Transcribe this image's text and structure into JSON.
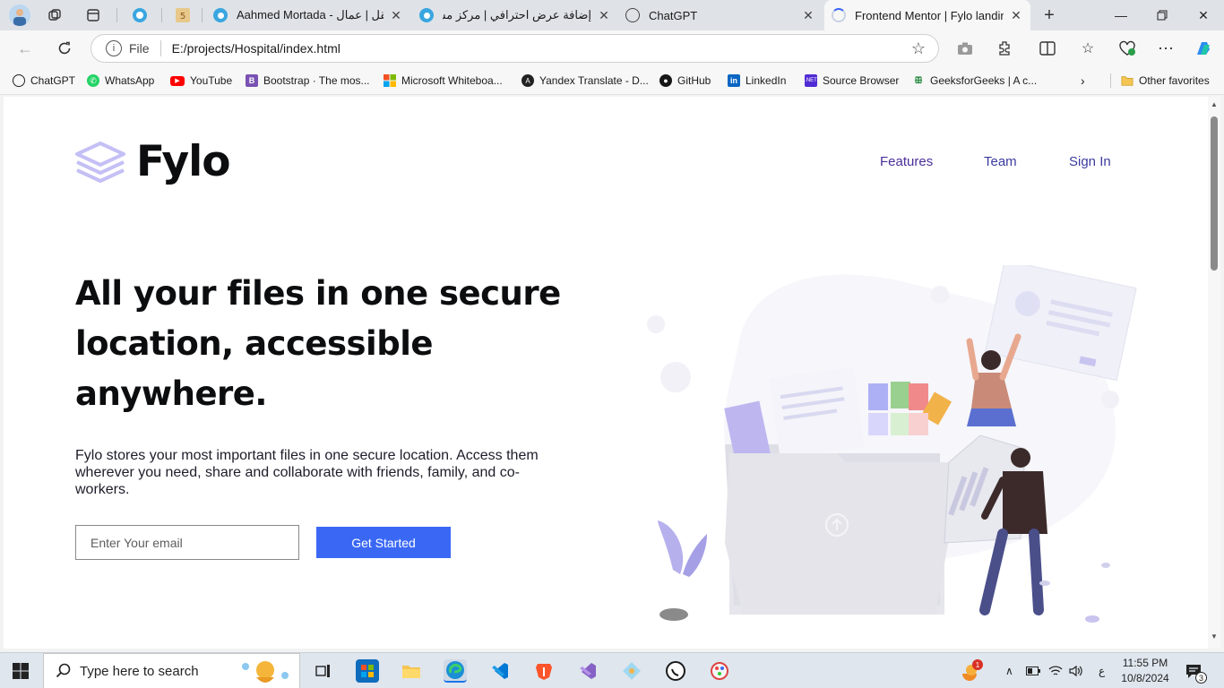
{
  "browser": {
    "tabs": [
      {
        "label": "Aahmed Mortada - مستقل | عمال",
        "icon": "globe-icon"
      },
      {
        "label": "إضافة عرض احترافي | مركز مساعد",
        "icon": "globe-icon"
      },
      {
        "label": "ChatGPT",
        "icon": "openai-icon"
      },
      {
        "label": "Frontend Mentor | Fylo landing",
        "icon": "loading-icon"
      }
    ],
    "address_scheme": "File",
    "address": "E:/projects/Hospital/index.html"
  },
  "favorites": [
    {
      "label": "ChatGPT",
      "icon": "openai-icon",
      "color": "#222222"
    },
    {
      "label": "WhatsApp",
      "icon": "whatsapp-icon",
      "color": "#25D366"
    },
    {
      "label": "YouTube",
      "icon": "youtube-icon",
      "color": "#FF0000"
    },
    {
      "label": "Bootstrap · The mos...",
      "icon": "bootstrap-icon",
      "color": "#7952B3"
    },
    {
      "label": "Microsoft Whiteboa...",
      "icon": "microsoft-icon",
      "color": "#F25022"
    },
    {
      "label": "Yandex Translate - D...",
      "icon": "yandex-icon",
      "color": "#E62E2E"
    },
    {
      "label": "GitHub",
      "icon": "github-icon",
      "color": "#181717"
    },
    {
      "label": "LinkedIn",
      "icon": "linkedin-icon",
      "color": "#0A66C2"
    },
    {
      "label": "Source Browser",
      "icon": "dotnet-icon",
      "color": "#512BD4"
    },
    {
      "label": "GeeksforGeeks | A c...",
      "icon": "gfg-icon",
      "color": "#2F8D46"
    }
  ],
  "other_favorites": "Other favorites",
  "page": {
    "logo_text": "Fylo",
    "nav": [
      "Features",
      "Team",
      "Sign In"
    ],
    "title": "All your files in one secure location, accessible anywhere.",
    "text": "Fylo stores your most important files in one secure location. Access them wherever you need, share and collaborate with friends, family, and co-workers.",
    "email_placeholder": "Enter Your email",
    "cta": "Get Started"
  },
  "taskbar": {
    "search_placeholder": "Type here to search",
    "time": "11:55 PM",
    "date": "10/8/2024",
    "lang": "ع",
    "notification_count": "3",
    "badge": "1"
  },
  "colors": {
    "accent": "#3A68F4",
    "nav_link": "#3B3B9E",
    "logo_mark": "#C4C0F5"
  }
}
